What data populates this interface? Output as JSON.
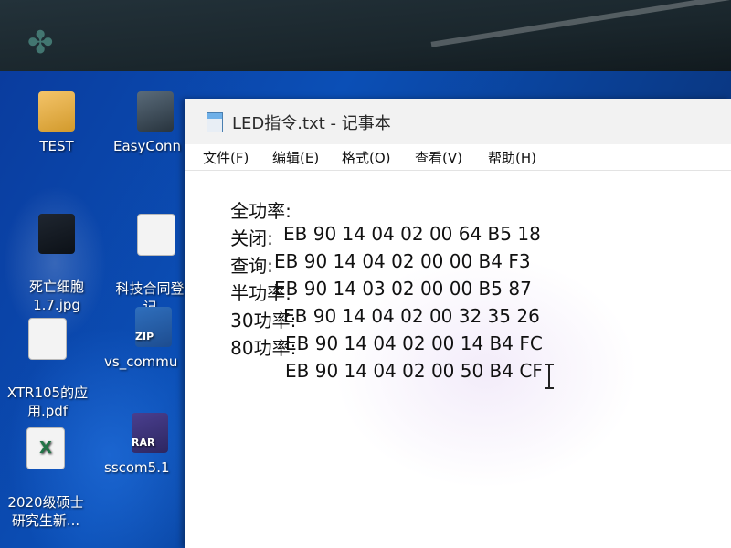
{
  "notepad": {
    "title": "LED指令.txt - 记事本",
    "menu": [
      "文件(F)",
      "编辑(E)",
      "格式(O)",
      "查看(V)",
      "帮助(H)"
    ],
    "lines": [
      {
        "label": "全功率:",
        "hex": "EB 90 14 04 02 00 64 B5 18"
      },
      {
        "label": "关闭:",
        "hex": "EB 90 14 04 02 00 00 B4 F3"
      },
      {
        "label": "查询:",
        "hex": "EB 90 14 03 02 00 00 B5 87"
      },
      {
        "label": "半功率:",
        "hex": "EB 90 14 04 02 00 32 35 26"
      },
      {
        "label": "30功率:",
        "hex": "EB 90 14 04 02 00 14 B4 FC"
      },
      {
        "label": "80功率:",
        "hex": "EB 90 14 04 02 00 50 B4 CF"
      }
    ]
  },
  "desktop": {
    "icons": [
      {
        "name": "desktop-icon-test",
        "label": "TEST",
        "glyph": "folder-icon"
      },
      {
        "name": "desktop-icon-easyconnect",
        "label": "EasyConn",
        "glyph": "easyconnect-icon"
      },
      {
        "name": "desktop-icon-jpg",
        "label": "死亡细胞\n1.7.jpg",
        "glyph": "image-file-icon"
      },
      {
        "name": "desktop-icon-doc",
        "label": "科技合同登\n记",
        "glyph": "document-icon"
      },
      {
        "name": "desktop-icon-pdf",
        "label": "XTR105的应\n用.pdf",
        "glyph": "pdf-file-icon"
      },
      {
        "name": "desktop-icon-zip",
        "label": "vs_commu",
        "glyph": "zip-archive-icon"
      },
      {
        "name": "desktop-icon-xls",
        "label": "2020级硕士\n研究生新...",
        "glyph": "excel-file-icon"
      },
      {
        "name": "desktop-icon-rar",
        "label": "sscom5.1",
        "glyph": "rar-archive-icon"
      }
    ]
  },
  "colors": {
    "desktop_blue": "#0b4fb6",
    "titlebar_bg": "#f2f2f2",
    "editor_bg": "#ffffff"
  }
}
